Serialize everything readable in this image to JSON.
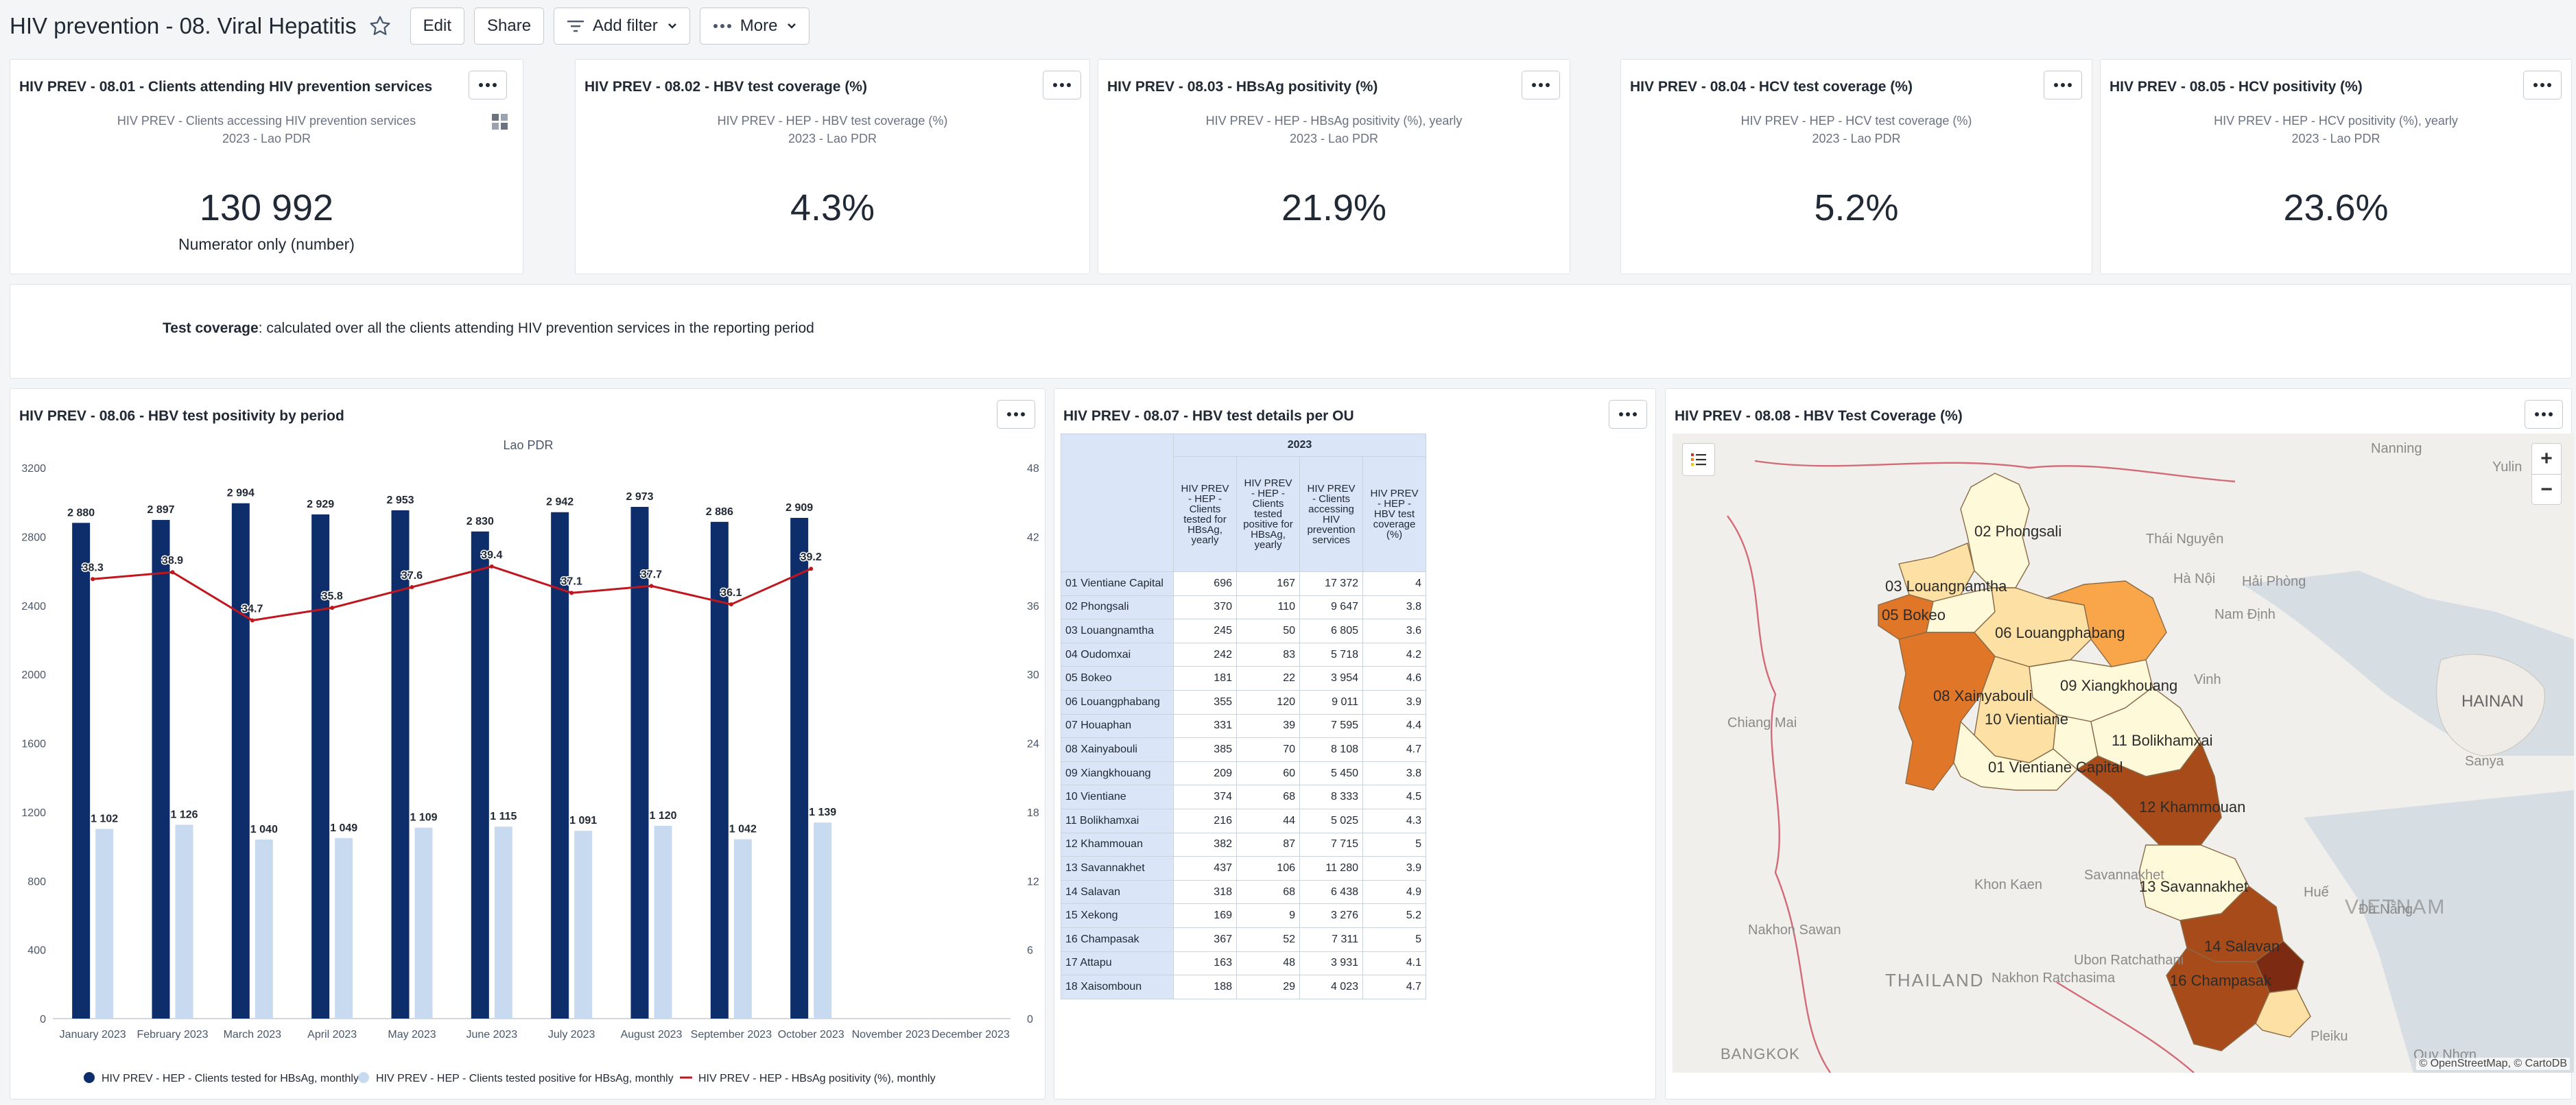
{
  "dashboard": {
    "title": "HIV prevention - 08. Viral Hepatitis",
    "edit_label": "Edit",
    "share_label": "Share",
    "add_filter_label": "Add filter",
    "more_label": "More"
  },
  "cards": {
    "c801": {
      "title": "HIV PREV - 08.01 - Clients attending HIV prevention services",
      "subtitle": "HIV PREV - Clients accessing HIV prevention services",
      "period": "2023 - Lao PDR",
      "value": "130 992",
      "caption": "Numerator only (number)"
    },
    "c802": {
      "title": "HIV PREV - 08.02 - HBV test coverage (%)",
      "subtitle": "HIV PREV - HEP - HBV test coverage (%)",
      "period": "2023 - Lao PDR",
      "value": "4.3%"
    },
    "c803": {
      "title": "HIV PREV - 08.03 - HBsAg positivity (%)",
      "subtitle": "HIV PREV - HEP - HBsAg positivity (%), yearly",
      "period": "2023 - Lao PDR",
      "value": "21.9%"
    },
    "c804": {
      "title": "HIV PREV - 08.04 - HCV test coverage (%)",
      "subtitle": "HIV PREV - HEP - HCV test coverage (%)",
      "period": "2023 - Lao PDR",
      "value": "5.2%"
    },
    "c805": {
      "title": "HIV PREV - 08.05 - HCV positivity (%)",
      "subtitle": "HIV PREV - HEP - HCV positivity (%), yearly",
      "period": "2023 - Lao PDR",
      "value": "23.6%"
    },
    "text": {
      "bold": "Test coverage",
      "rest": ": calculated over all the clients attending HIV prevention services in the reporting period"
    },
    "c806": {
      "title": "HIV PREV - 08.06 - HBV test positivity by period"
    },
    "c807": {
      "title": "HIV PREV - 08.07 - HBV test details per OU"
    },
    "c808": {
      "title": "HIV PREV - 08.08 - HBV Test Coverage (%)"
    }
  },
  "chart_data": {
    "type": "bar",
    "title": "Lao PDR",
    "categories": [
      "January 2023",
      "February 2023",
      "March 2023",
      "April 2023",
      "May 2023",
      "June 2023",
      "July 2023",
      "August 2023",
      "September 2023",
      "October 2023",
      "November 2023",
      "December 2023"
    ],
    "series": [
      {
        "name": "HIV PREV - HEP - Clients tested for HBsAg, monthly",
        "type": "bar",
        "axis": "left",
        "color": "#0d2d6b",
        "values": [
          2880,
          2897,
          2994,
          2929,
          2953,
          2830,
          2942,
          2973,
          2886,
          2909,
          null,
          null
        ]
      },
      {
        "name": "HIV PREV - HEP - Clients tested positive for HBsAg, monthly",
        "type": "bar",
        "axis": "left",
        "color": "#c7daf0",
        "values": [
          1102,
          1126,
          1040,
          1049,
          1109,
          1115,
          1091,
          1120,
          1042,
          1139,
          null,
          null
        ]
      },
      {
        "name": "HIV PREV - HEP - HBsAg positivity (%), monthly",
        "type": "line",
        "axis": "right",
        "color": "#c0171f",
        "values": [
          38.3,
          38.9,
          34.7,
          35.8,
          37.6,
          39.4,
          37.1,
          37.7,
          36.1,
          39.2,
          null,
          null
        ]
      }
    ],
    "left_axis": {
      "range": [
        0,
        3200
      ],
      "ticks": [
        0,
        400,
        800,
        1200,
        1600,
        2000,
        2400,
        2800,
        3200
      ]
    },
    "right_axis": {
      "range": [
        0,
        48
      ],
      "ticks": [
        0,
        6,
        12,
        18,
        24,
        30,
        36,
        42,
        48
      ]
    },
    "grid": false,
    "legend": "bottom"
  },
  "table": {
    "year": "2023",
    "columns": [
      "HIV PREV - HEP - Clients tested for HBsAg, yearly",
      "HIV PREV - HEP - Clients tested positive for HBsAg, yearly",
      "HIV PREV - Clients accessing HIV prevention services",
      "HIV PREV - HEP - HBV test coverage (%)"
    ],
    "rows": [
      {
        "ou": "01 Vientiane Capital",
        "tested": "696",
        "positive": "167",
        "clients": "17 372",
        "coverage": "4"
      },
      {
        "ou": "02 Phongsali",
        "tested": "370",
        "positive": "110",
        "clients": "9 647",
        "coverage": "3.8"
      },
      {
        "ou": "03 Louangnamtha",
        "tested": "245",
        "positive": "50",
        "clients": "6 805",
        "coverage": "3.6"
      },
      {
        "ou": "04 Oudomxai",
        "tested": "242",
        "positive": "83",
        "clients": "5 718",
        "coverage": "4.2"
      },
      {
        "ou": "05 Bokeo",
        "tested": "181",
        "positive": "22",
        "clients": "3 954",
        "coverage": "4.6"
      },
      {
        "ou": "06 Louangphabang",
        "tested": "355",
        "positive": "120",
        "clients": "9 011",
        "coverage": "3.9"
      },
      {
        "ou": "07 Houaphan",
        "tested": "331",
        "positive": "39",
        "clients": "7 595",
        "coverage": "4.4"
      },
      {
        "ou": "08 Xainyabouli",
        "tested": "385",
        "positive": "70",
        "clients": "8 108",
        "coverage": "4.7"
      },
      {
        "ou": "09 Xiangkhouang",
        "tested": "209",
        "positive": "60",
        "clients": "5 450",
        "coverage": "3.8"
      },
      {
        "ou": "10 Vientiane",
        "tested": "374",
        "positive": "68",
        "clients": "8 333",
        "coverage": "4.5"
      },
      {
        "ou": "11 Bolikhamxai",
        "tested": "216",
        "positive": "44",
        "clients": "5 025",
        "coverage": "4.3"
      },
      {
        "ou": "12 Khammouan",
        "tested": "382",
        "positive": "87",
        "clients": "7 715",
        "coverage": "5"
      },
      {
        "ou": "13 Savannakhet",
        "tested": "437",
        "positive": "106",
        "clients": "11 280",
        "coverage": "3.9"
      },
      {
        "ou": "14 Salavan",
        "tested": "318",
        "positive": "68",
        "clients": "6 438",
        "coverage": "4.9"
      },
      {
        "ou": "15 Xekong",
        "tested": "169",
        "positive": "9",
        "clients": "3 276",
        "coverage": "5.2"
      },
      {
        "ou": "16 Champasak",
        "tested": "367",
        "positive": "52",
        "clients": "7 311",
        "coverage": "5"
      },
      {
        "ou": "17 Attapu",
        "tested": "163",
        "positive": "48",
        "clients": "3 931",
        "coverage": "4.1"
      },
      {
        "ou": "18 Xaisomboun",
        "tested": "188",
        "positive": "29",
        "clients": "4 023",
        "coverage": "4.7"
      }
    ]
  },
  "map": {
    "province_labels": [
      "02 Phongsali",
      "03 Louangnamtha",
      "05 Bokeo",
      "06 Louangphabang",
      "09 Xiangkhouang",
      "08 Xainyabouli",
      "10 Vientiane",
      "11 Bolikhamxai",
      "01 Vientiane Capital",
      "12 Khammouan",
      "13 Savannakhet",
      "14 Salavan",
      "16 Champasak"
    ],
    "place_labels": [
      "Nanning",
      "Yulin",
      "Thái Nguyên",
      "Hà Nội",
      "Hải Phòng",
      "Nam Định",
      "Vinh",
      "HAINAN",
      "Sanya",
      "Chiang Mai",
      "Huế",
      "Đà Nẵng",
      "Khon Kaen",
      "Savannakhet",
      "Nakhon Sawan",
      "Ubon Ratchathani",
      "Nakhon Ratchasima",
      "THAILAND",
      "VIETNAM",
      "BANGKOK",
      "Pleiku",
      "Quy Nhơn"
    ],
    "zoom_in": "+",
    "zoom_out": "−",
    "attribution": "© OpenStreetMap, © CartoDB",
    "palette": [
      "#fef9d9",
      "#fde0a3",
      "#f9a64b",
      "#e07628",
      "#a84b1a",
      "#7c2a12"
    ]
  }
}
